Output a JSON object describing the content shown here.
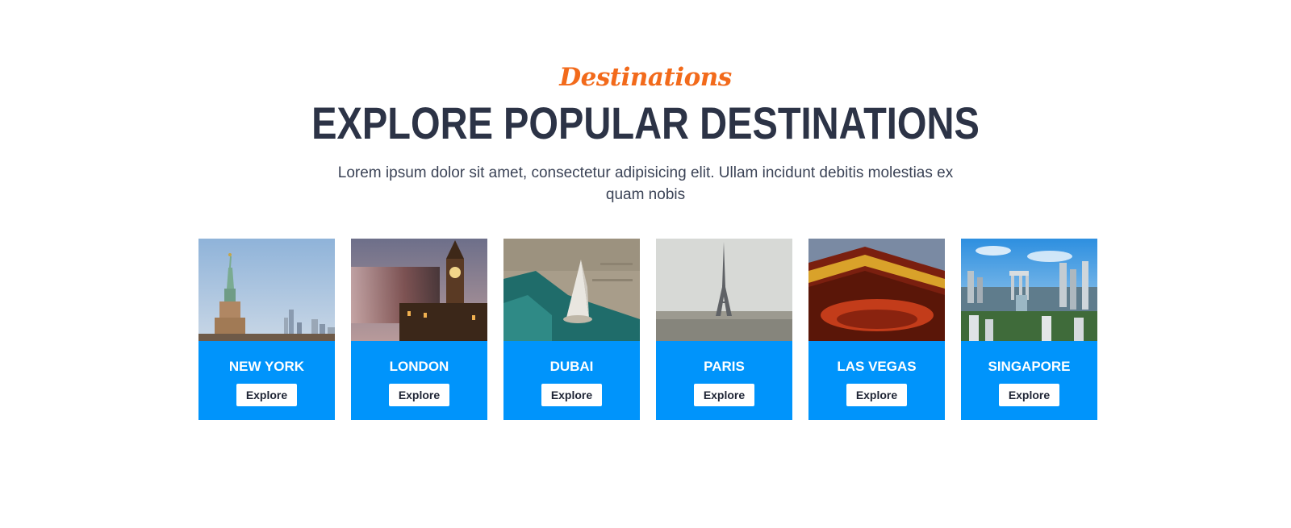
{
  "header": {
    "eyebrow": "Destinations",
    "title": "EXPLORE POPULAR DESTINATIONS",
    "subtitle": "Lorem ipsum dolor sit amet, consectetur adipisicing elit. Ullam incidunt debitis molestias ex quam nobis"
  },
  "destinations": [
    {
      "name": "NEW YORK",
      "button": "Explore",
      "image": "statue-of-liberty-skyline-photo"
    },
    {
      "name": "LONDON",
      "button": "Explore",
      "image": "big-ben-motion-bus-photo"
    },
    {
      "name": "DUBAI",
      "button": "Explore",
      "image": "burj-al-arab-aerial-photo"
    },
    {
      "name": "PARIS",
      "button": "Explore",
      "image": "eiffel-tower-cityscape-photo"
    },
    {
      "name": "LAS VEGAS",
      "button": "Explore",
      "image": "circus-circus-marquee-photo"
    },
    {
      "name": "SINGAPORE",
      "button": "Explore",
      "image": "marina-bay-skyline-photo"
    }
  ],
  "colors": {
    "accent_orange": "#f26a1b",
    "heading": "#2c3346",
    "card_blue": "#0094fb",
    "button_bg": "#ffffff"
  }
}
